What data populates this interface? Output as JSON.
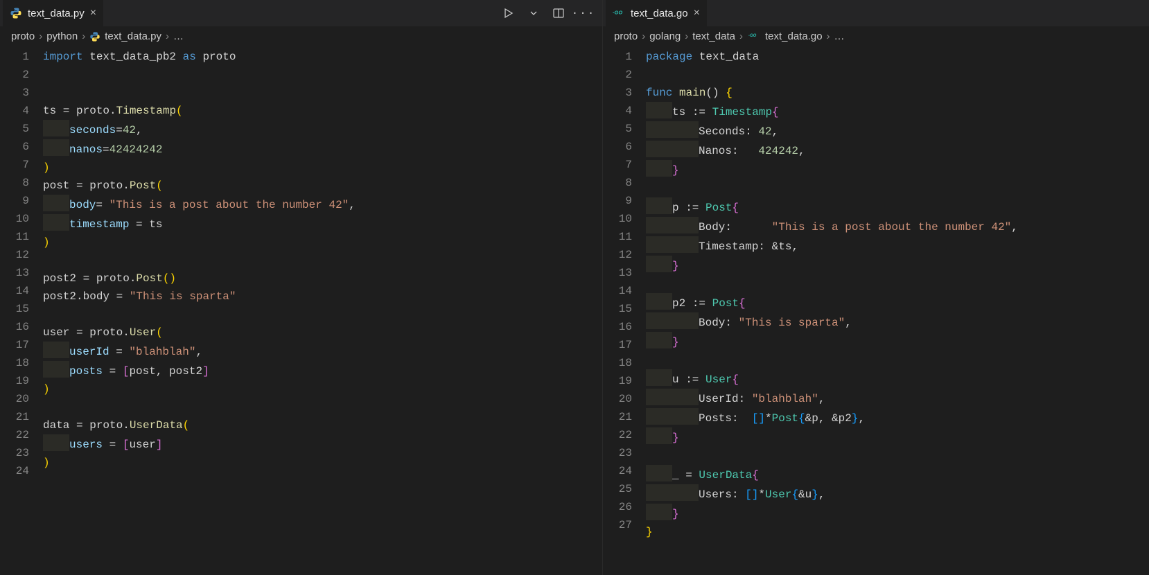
{
  "leftPane": {
    "tab": {
      "filename": "text_data.py",
      "lang": "python"
    },
    "breadcrumb": [
      "proto",
      "python",
      "text_data.py",
      "…"
    ],
    "lineCount": 24,
    "lines": [
      [
        [
          "import",
          "kw"
        ],
        [
          " text_data_pb2 ",
          "op"
        ],
        [
          "as",
          "kw"
        ],
        [
          " proto",
          "op"
        ]
      ],
      [],
      [],
      [
        [
          "ts = proto.",
          "op"
        ],
        [
          "Timestamp",
          "fn"
        ],
        [
          "(",
          "brace-y"
        ]
      ],
      [
        [
          "    ",
          "ih"
        ],
        [
          "seconds",
          "var"
        ],
        [
          "=",
          "op"
        ],
        [
          "42",
          "num"
        ],
        [
          ",",
          "op"
        ]
      ],
      [
        [
          "    ",
          "ih"
        ],
        [
          "nanos",
          "var"
        ],
        [
          "=",
          "op"
        ],
        [
          "42424242",
          "num"
        ]
      ],
      [
        [
          ")",
          "brace-y"
        ]
      ],
      [
        [
          "post = proto.",
          "op"
        ],
        [
          "Post",
          "fn"
        ],
        [
          "(",
          "brace-y"
        ]
      ],
      [
        [
          "    ",
          "ih"
        ],
        [
          "body",
          "var"
        ],
        [
          "= ",
          "op"
        ],
        [
          "\"This is a post about the number 42\"",
          "str"
        ],
        [
          ",",
          "op"
        ]
      ],
      [
        [
          "    ",
          "ih"
        ],
        [
          "timestamp",
          "var"
        ],
        [
          " = ts",
          "op"
        ]
      ],
      [
        [
          ")",
          "brace-y"
        ]
      ],
      [],
      [
        [
          "post2 = proto.",
          "op"
        ],
        [
          "Post",
          "fn"
        ],
        [
          "()",
          "brace-y"
        ]
      ],
      [
        [
          "post2.body = ",
          "op"
        ],
        [
          "\"This is sparta\"",
          "str"
        ]
      ],
      [],
      [
        [
          "user = proto.",
          "op"
        ],
        [
          "User",
          "fn"
        ],
        [
          "(",
          "brace-y"
        ]
      ],
      [
        [
          "    ",
          "ih"
        ],
        [
          "userId",
          "var"
        ],
        [
          " = ",
          "op"
        ],
        [
          "\"blahblah\"",
          "str"
        ],
        [
          ",",
          "op"
        ]
      ],
      [
        [
          "    ",
          "ih"
        ],
        [
          "posts",
          "var"
        ],
        [
          " = ",
          "op"
        ],
        [
          "[",
          "brace-m"
        ],
        [
          "post, post2",
          "op"
        ],
        [
          "]",
          "brace-m"
        ]
      ],
      [
        [
          ")",
          "brace-y"
        ]
      ],
      [],
      [
        [
          "data = proto.",
          "op"
        ],
        [
          "UserData",
          "fn"
        ],
        [
          "(",
          "brace-y"
        ]
      ],
      [
        [
          "    ",
          "ih"
        ],
        [
          "users",
          "var"
        ],
        [
          " = ",
          "op"
        ],
        [
          "[",
          "brace-m"
        ],
        [
          "user",
          "op"
        ],
        [
          "]",
          "brace-m"
        ]
      ],
      [
        [
          ")",
          "brace-y"
        ]
      ],
      []
    ]
  },
  "rightPane": {
    "tab": {
      "filename": "text_data.go",
      "lang": "go"
    },
    "breadcrumb": [
      "proto",
      "golang",
      "text_data",
      "text_data.go",
      "…"
    ],
    "lineCount": 27,
    "lines": [
      [
        [
          "package",
          "kw"
        ],
        [
          " text_data",
          "op"
        ]
      ],
      [],
      [
        [
          "func",
          "kw"
        ],
        [
          " ",
          "op"
        ],
        [
          "main",
          "fn"
        ],
        [
          "() ",
          "op"
        ],
        [
          "{",
          "brace-y"
        ]
      ],
      [
        [
          "    ",
          "ih"
        ],
        [
          "ts ",
          "op"
        ],
        [
          ":=",
          "op"
        ],
        [
          " ",
          "op"
        ],
        [
          "Timestamp",
          "pkg"
        ],
        [
          "{",
          "brace-m"
        ]
      ],
      [
        [
          "        ",
          "ih2"
        ],
        [
          "Seconds: ",
          "op"
        ],
        [
          "42",
          "num"
        ],
        [
          ",",
          "op"
        ]
      ],
      [
        [
          "        ",
          "ih2"
        ],
        [
          "Nanos:   ",
          "op"
        ],
        [
          "424242",
          "num"
        ],
        [
          ",",
          "op"
        ]
      ],
      [
        [
          "    ",
          "ih"
        ],
        [
          "}",
          "brace-m"
        ]
      ],
      [],
      [
        [
          "    ",
          "ih"
        ],
        [
          "p ",
          "op"
        ],
        [
          ":=",
          "op"
        ],
        [
          " ",
          "op"
        ],
        [
          "Post",
          "pkg"
        ],
        [
          "{",
          "brace-m"
        ]
      ],
      [
        [
          "        ",
          "ih2"
        ],
        [
          "Body:      ",
          "op"
        ],
        [
          "\"This is a post about the number 42\"",
          "str"
        ],
        [
          ",",
          "op"
        ]
      ],
      [
        [
          "        ",
          "ih2"
        ],
        [
          "Timestamp: ",
          "op"
        ],
        [
          "&",
          "op"
        ],
        [
          "ts,",
          "op"
        ]
      ],
      [
        [
          "    ",
          "ih"
        ],
        [
          "}",
          "brace-m"
        ]
      ],
      [],
      [
        [
          "    ",
          "ih"
        ],
        [
          "p2 ",
          "op"
        ],
        [
          ":=",
          "op"
        ],
        [
          " ",
          "op"
        ],
        [
          "Post",
          "pkg"
        ],
        [
          "{",
          "brace-m"
        ]
      ],
      [
        [
          "        ",
          "ih2"
        ],
        [
          "Body: ",
          "op"
        ],
        [
          "\"This is sparta\"",
          "str"
        ],
        [
          ",",
          "op"
        ]
      ],
      [
        [
          "    ",
          "ih"
        ],
        [
          "}",
          "brace-m"
        ]
      ],
      [],
      [
        [
          "    ",
          "ih"
        ],
        [
          "u ",
          "op"
        ],
        [
          ":=",
          "op"
        ],
        [
          " ",
          "op"
        ],
        [
          "User",
          "pkg"
        ],
        [
          "{",
          "brace-m"
        ]
      ],
      [
        [
          "        ",
          "ih2"
        ],
        [
          "UserId: ",
          "op"
        ],
        [
          "\"blahblah\"",
          "str"
        ],
        [
          ",",
          "op"
        ]
      ],
      [
        [
          "        ",
          "ih2"
        ],
        [
          "Posts:  ",
          "op"
        ],
        [
          "[]",
          "brace-b"
        ],
        [
          "*",
          "op"
        ],
        [
          "Post",
          "pkg"
        ],
        [
          "{",
          "brace-b"
        ],
        [
          "&",
          "op"
        ],
        [
          "p, ",
          "op"
        ],
        [
          "&",
          "op"
        ],
        [
          "p2",
          "op"
        ],
        [
          "}",
          "brace-b"
        ],
        [
          ",",
          "op"
        ]
      ],
      [
        [
          "    ",
          "ih"
        ],
        [
          "}",
          "brace-m"
        ]
      ],
      [],
      [
        [
          "    ",
          "ih"
        ],
        [
          "_ = ",
          "op"
        ],
        [
          "UserData",
          "pkg"
        ],
        [
          "{",
          "brace-m"
        ]
      ],
      [
        [
          "        ",
          "ih2"
        ],
        [
          "Users: ",
          "op"
        ],
        [
          "[]",
          "brace-b"
        ],
        [
          "*",
          "op"
        ],
        [
          "User",
          "pkg"
        ],
        [
          "{",
          "brace-b"
        ],
        [
          "&",
          "op"
        ],
        [
          "u",
          "op"
        ],
        [
          "}",
          "brace-b"
        ],
        [
          ",",
          "op"
        ]
      ],
      [
        [
          "    ",
          "ih"
        ],
        [
          "}",
          "brace-m"
        ]
      ],
      [
        [
          "}",
          "brace-y"
        ]
      ],
      []
    ]
  },
  "icons": {
    "python": "python-icon",
    "go": "go-icon",
    "close": "×",
    "chevron": "›",
    "ellipsis": "…"
  }
}
